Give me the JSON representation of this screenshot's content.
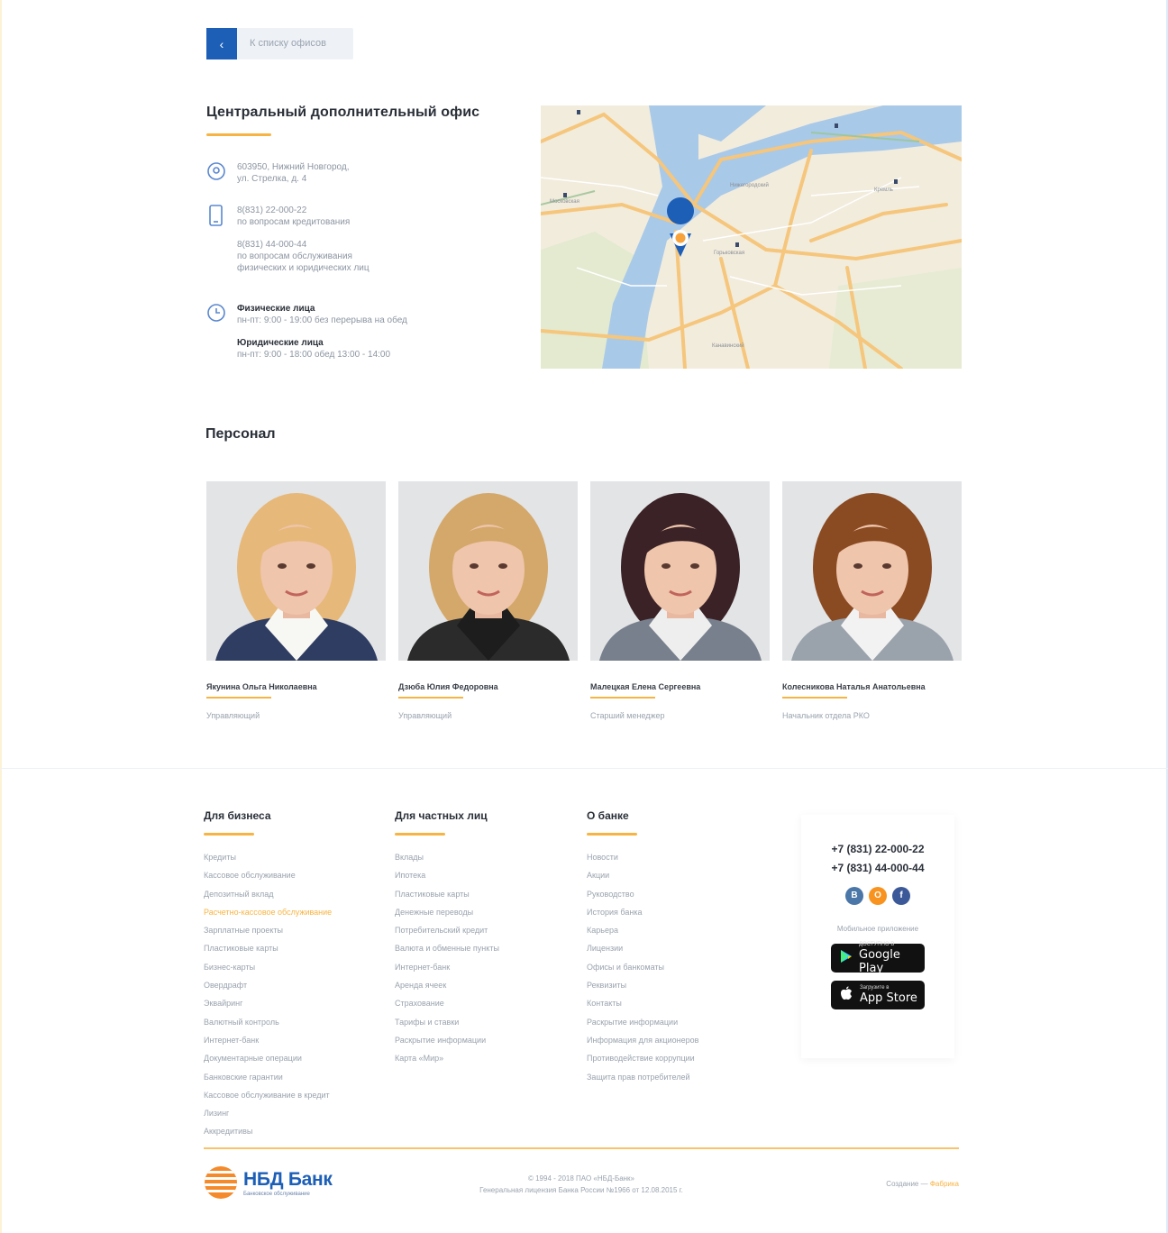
{
  "back": {
    "arrow": "‹",
    "label": "К списку офисов"
  },
  "office": {
    "title": "Центральный дополнительный офис",
    "address": [
      "603950, Нижний Новгород,",
      "ул. Стрелка, д. 4"
    ],
    "phone1": {
      "number": "8(831) 22-000-22",
      "note": "по вопросам кредитования"
    },
    "phone2": {
      "number": "8(831) 44-000-44",
      "note1": "по вопросам обслуживания",
      "note2": "физических и юридических лиц"
    },
    "hours": [
      {
        "title": "Физические лица",
        "text": "пн-пт: 9:00 - 19:00 без перерыва на обед"
      },
      {
        "title": "Юридические лица",
        "text": "пн-пт: 9:00 - 18:00 обед 13:00 - 14:00"
      }
    ]
  },
  "map": {
    "pin_icon": "map-pin-icon"
  },
  "staff": {
    "title": "Персонал",
    "people": [
      {
        "name": "Якунина Ольга Николаевна",
        "role": "Управляющий",
        "hair": "#e6b879",
        "jacket": "#2f3d62",
        "top": "#f7f7f3"
      },
      {
        "name": "Дзюба Юлия Федоровна",
        "role": "Управляющий",
        "hair": "#d3a86a",
        "jacket": "#2b2b2b",
        "top": "#1d1d1d"
      },
      {
        "name": "Малецкая Елена Сергеевна",
        "role": "Старший менеджер",
        "hair": "#3a2226",
        "jacket": "#77808c",
        "top": "#eeeeee"
      },
      {
        "name": "Колесникова Наталья Анатольевна",
        "role": "Начальник отдела РКО",
        "hair": "#8a4a22",
        "jacket": "#9aa3ab",
        "top": "#f2f2f2"
      }
    ]
  },
  "footer": {
    "business": {
      "title": "Для бизнеса",
      "links": [
        "Кредиты",
        "Кассовое обслуживание",
        "Депозитный вклад",
        "Расчетно-кассовое обслуживание",
        "Зарплатные проекты",
        "Пластиковые карты",
        "Бизнес-карты",
        "Овердрафт",
        "Эквайринг",
        "Валютный контроль",
        "Интернет-банк",
        "Документарные операции",
        "Банковские гарантии",
        "Кассовое обслуживание в кредит",
        "Лизинг",
        "Аккредитивы"
      ],
      "highlight": 3
    },
    "private": {
      "title": "Для частных лиц",
      "links": [
        "Вклады",
        "Ипотека",
        "Пластиковые карты",
        "Денежные переводы",
        "Потребительский кредит",
        "Валюта и обменные пункты",
        "Интернет-банк",
        "Аренда ячеек",
        "Страхование",
        "Тарифы и ставки",
        "Раскрытие информации",
        "Карта «Мир»"
      ]
    },
    "about": {
      "title": "О банке",
      "links": [
        "Новости",
        "Акции",
        "Руководство",
        "История банка",
        "Карьера",
        "Лицензии",
        "Офисы и банкоматы",
        "Реквизиты",
        "Контакты",
        "Раскрытие информации",
        "Информация для акционеров",
        "Противодействие коррупции",
        "Защита прав потребителей"
      ]
    },
    "contacts": {
      "phone1": "+7 (831) 22-000-22",
      "phone2": "+7 (831) 44-000-44",
      "socials": [
        {
          "icon": "vk-icon",
          "glyph": "В",
          "color": "#4a76a8"
        },
        {
          "icon": "ok-icon",
          "glyph": "О",
          "color": "#f7931e"
        },
        {
          "icon": "facebook-icon",
          "glyph": "f",
          "color": "#3b5998"
        }
      ],
      "apps_label": "Мобильное приложение",
      "google": {
        "small": "ДОСТУПНО В",
        "big": "Google Play"
      },
      "apple": {
        "small": "Загрузите в",
        "big": "App Store"
      }
    },
    "logo": {
      "name": "НБД Банк",
      "tagline": "Банковское обслуживание"
    },
    "copyright": [
      "© 1994 - 2018 ПАО «НБД-Банк»",
      "Генеральная лицензия Банка России №1966 от 12.08.2015 г."
    ],
    "made_by": {
      "prefix": "Создание —",
      "studio": "Фабрика"
    }
  },
  "colors": {
    "accent": "#f7b443",
    "brand": "#1d5fb7"
  }
}
